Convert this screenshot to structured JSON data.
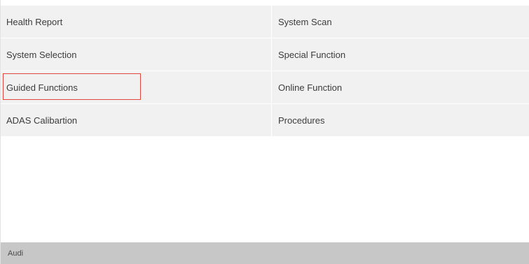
{
  "menu": {
    "rows": [
      {
        "left": "Health Report",
        "right": "System Scan"
      },
      {
        "left": "System Selection",
        "right": "Special Function"
      },
      {
        "left": "Guided Functions",
        "right": "Online Function"
      },
      {
        "left": "ADAS Calibartion",
        "right": "Procedures"
      }
    ],
    "highlighted": "Guided Functions"
  },
  "footer": {
    "brand": "Audi"
  },
  "colors": {
    "cell_background": "#f1f1f1",
    "highlight_border": "#e0453e",
    "footer_background": "#c7c7c7"
  }
}
